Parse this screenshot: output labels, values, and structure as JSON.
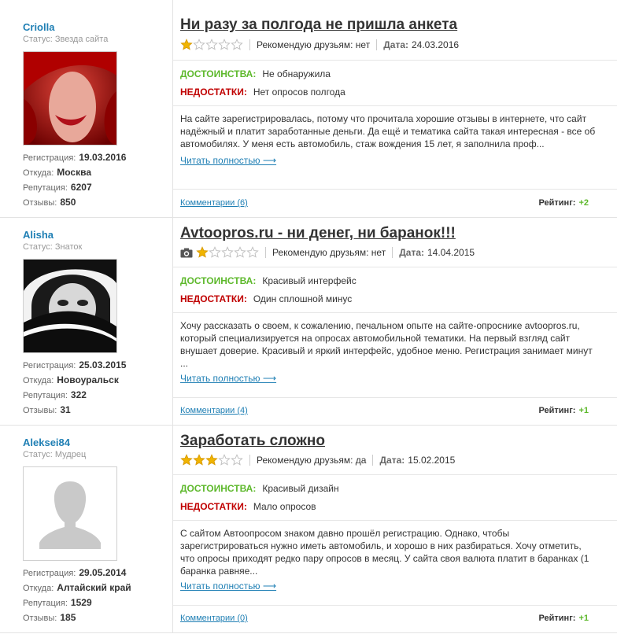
{
  "reviews": [
    {
      "user": {
        "name": "Criolla",
        "status": "Статус: Звезда сайта",
        "reg_label": "Регистрация:",
        "reg": "19.03.2016",
        "from_label": "Откуда:",
        "from": "Москва",
        "rep_label": "Репутация:",
        "rep": "6207",
        "revs_label": "Отзывы:",
        "revs": "850"
      },
      "title": "Ни разу за полгода не пришла анкета",
      "stars": 1,
      "recommend": "Рекомендую друзьям: нет",
      "date_label": "Дата:",
      "date": "24.03.2016",
      "pros_label": "ДОСТОИНСТВА:",
      "pros": "Не обнаружила",
      "cons_label": "НЕДОСТАТКИ:",
      "cons": "Нет опросов полгода",
      "text": "На сайте зарегистрировалась, потому что прочитала хорошие отзывы в интернете, что сайт надёжный и платит заработанные деньги. Да ещё и тематика сайта такая интересная - все об автомобилях. У меня есть автомобиль, стаж вождения 15 лет, я заполнила проф...",
      "read_more": "Читать полностью ⟶",
      "comments": "Комментарии (6)",
      "rating_label": "Рейтинг:",
      "rating": "+2"
    },
    {
      "user": {
        "name": "Alisha",
        "status": "Статус: Знаток",
        "reg_label": "Регистрация:",
        "reg": "25.03.2015",
        "from_label": "Откуда:",
        "from": "Новоуральск",
        "rep_label": "Репутация:",
        "rep": "322",
        "revs_label": "Отзывы:",
        "revs": "31"
      },
      "title": "Avtoopros.ru - ни денег, ни баранок!!!",
      "stars": 1,
      "recommend": "Рекомендую друзьям: нет",
      "date_label": "Дата:",
      "date": "14.04.2015",
      "pros_label": "ДОСТОИНСТВА:",
      "pros": "Красивый интерфейс",
      "cons_label": "НЕДОСТАТКИ:",
      "cons": "Один сплошной минус",
      "text": "Хочу рассказать о своем, к сожалению, печальном опыте на сайте-опроснике avtoopros.ru, который специализируется на опросах автомобильной тематики. На первый взгляд сайт внушает доверие. Красивый и яркий интерфейс, удобное меню. Регистрация занимает минут ...",
      "read_more": "Читать полностью ⟶",
      "comments": "Комментарии (4)",
      "rating_label": "Рейтинг:",
      "rating": "+1"
    },
    {
      "user": {
        "name": "Aleksei84",
        "status": "Статус: Мудрец",
        "reg_label": "Регистрация:",
        "reg": "29.05.2014",
        "from_label": "Откуда:",
        "from": "Алтайский край",
        "rep_label": "Репутация:",
        "rep": "1529",
        "revs_label": "Отзывы:",
        "revs": "185"
      },
      "title": "Заработать сложно",
      "stars": 3,
      "recommend": "Рекомендую друзьям: да",
      "date_label": "Дата:",
      "date": "15.02.2015",
      "pros_label": "ДОСТОИНСТВА:",
      "pros": "Красивый дизайн",
      "cons_label": "НЕДОСТАТКИ:",
      "cons": "Мало опросов",
      "text": "С сайтом Автоопросом знаком давно прошёл регистрацию. Однако, чтобы зарегистрироваться нужно иметь автомобиль, и хорошо в них разбираться. Хочу отметить, что опросы приходят редко пару опросов в месяц. У сайта своя валюта платит в баранках (1 баранка равняе...",
      "read_more": "Читать полностью ⟶",
      "comments": "Комментарии (0)",
      "rating_label": "Рейтинг:",
      "rating": "+1"
    }
  ],
  "colors": {
    "link": "#1f7fb4",
    "pros": "#5db82b",
    "cons": "#c00000",
    "star": "#f0b400"
  },
  "icons": {
    "star": "star-icon",
    "camera": "camera-icon"
  }
}
